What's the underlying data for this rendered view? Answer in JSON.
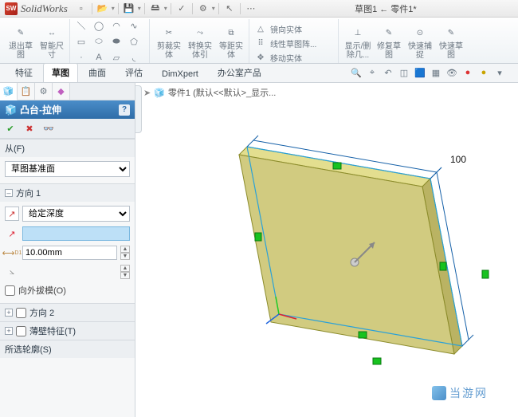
{
  "app": {
    "name": "SolidWorks",
    "logo_text": "SW"
  },
  "title": "草图1 ← 零件1*",
  "qat_icons": [
    "new",
    "open",
    "save",
    "print",
    "undo",
    "redo",
    "options",
    "rebuild",
    "select",
    "view"
  ],
  "ribbon": {
    "big_buttons": [
      {
        "label": "退出草\n图",
        "icon": "exit-sketch"
      },
      {
        "label": "智能尺\n寸",
        "icon": "dimension"
      }
    ],
    "big_right": [
      {
        "label": "剪裁实\n体",
        "icon": "trim"
      },
      {
        "label": "转换实\n体引",
        "icon": "convert"
      },
      {
        "label": "等距实\n体",
        "icon": "offset"
      }
    ],
    "far_right": [
      {
        "label": "显示/删\n除几...",
        "icon": "show-delete"
      },
      {
        "label": "修复草\n图",
        "icon": "repair"
      },
      {
        "label": "快速捕\n捉",
        "icon": "snap"
      },
      {
        "label": "快速草\n图",
        "icon": "quick-sketch"
      }
    ],
    "mid_text": [
      {
        "label": "镜向实体",
        "icon": "mirror"
      },
      {
        "label": "线性草图阵...",
        "icon": "linear-pattern"
      },
      {
        "label": "移动实体",
        "icon": "move"
      }
    ]
  },
  "tabs": {
    "items": [
      "特征",
      "草图",
      "曲面",
      "评估",
      "DimXpert",
      "办公室产品"
    ],
    "active": "草图"
  },
  "panel": {
    "feature_title": "凸台-拉伸",
    "help": "?",
    "from": {
      "label": "从(F)",
      "value": "草图基准面"
    },
    "dir1": {
      "label": "方向 1",
      "end_condition": "给定深度",
      "depth_value": "",
      "depth": "10.00mm",
      "draft_label": "向外拔模(O)"
    },
    "dir2": {
      "label": "方向 2"
    },
    "thin": {
      "label": "薄壁特征(T)"
    },
    "contours": {
      "label": "所选轮廓(S)"
    }
  },
  "viewport": {
    "breadcrumb": "零件1 (默认<<默认>_显示...",
    "dimension_100": "100"
  },
  "watermark": "当游网"
}
